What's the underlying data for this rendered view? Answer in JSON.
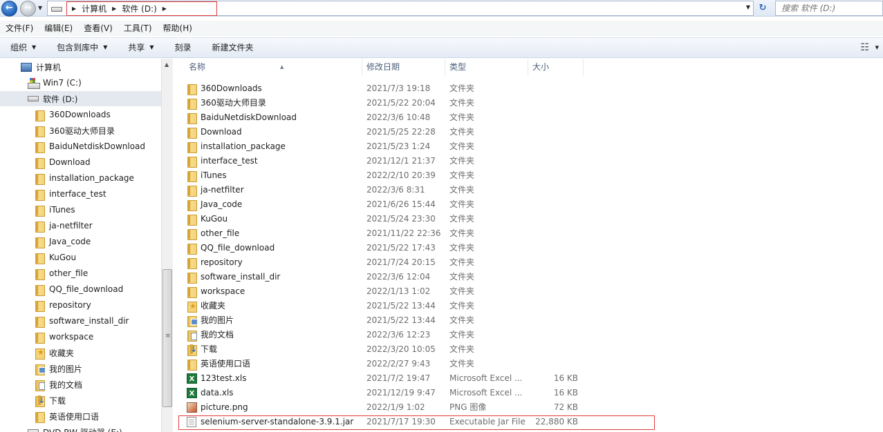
{
  "address": {
    "crumbs": [
      "计算机",
      "软件 (D:)"
    ],
    "search_placeholder": "搜索 软件 (D:)"
  },
  "menu": [
    "文件(F)",
    "编辑(E)",
    "查看(V)",
    "工具(T)",
    "帮助(H)"
  ],
  "commands": [
    {
      "label": "组织",
      "dropdown": true
    },
    {
      "label": "包含到库中",
      "dropdown": true
    },
    {
      "label": "共享",
      "dropdown": true
    },
    {
      "label": "刻录",
      "dropdown": false
    },
    {
      "label": "新建文件夹",
      "dropdown": false
    }
  ],
  "tree": [
    {
      "label": "计算机",
      "icon": "computer-icon",
      "depth": 0
    },
    {
      "label": "Win7 (C:)",
      "icon": "windows-drive-icon",
      "depth": 1
    },
    {
      "label": "软件 (D:)",
      "icon": "hard-drive-icon",
      "depth": 1,
      "selected": true
    },
    {
      "label": "360Downloads",
      "icon": "folder-icon",
      "depth": 2
    },
    {
      "label": "360驱动大师目录",
      "icon": "folder-icon",
      "depth": 2
    },
    {
      "label": "BaiduNetdiskDownload",
      "icon": "folder-icon",
      "depth": 2
    },
    {
      "label": "Download",
      "icon": "folder-icon",
      "depth": 2
    },
    {
      "label": "installation_package",
      "icon": "folder-icon",
      "depth": 2
    },
    {
      "label": "interface_test",
      "icon": "folder-icon",
      "depth": 2
    },
    {
      "label": "iTunes",
      "icon": "folder-icon",
      "depth": 2
    },
    {
      "label": "ja-netfilter",
      "icon": "folder-icon",
      "depth": 2
    },
    {
      "label": "Java_code",
      "icon": "folder-icon",
      "depth": 2
    },
    {
      "label": "KuGou",
      "icon": "folder-icon",
      "depth": 2
    },
    {
      "label": "other_file",
      "icon": "folder-icon",
      "depth": 2
    },
    {
      "label": "QQ_file_download",
      "icon": "folder-icon",
      "depth": 2
    },
    {
      "label": "repository",
      "icon": "folder-icon",
      "depth": 2
    },
    {
      "label": "software_install_dir",
      "icon": "folder-icon",
      "depth": 2
    },
    {
      "label": "workspace",
      "icon": "folder-icon",
      "depth": 2
    },
    {
      "label": "收藏夹",
      "icon": "favorites-folder-icon",
      "depth": 2
    },
    {
      "label": "我的图片",
      "icon": "pictures-folder-icon",
      "depth": 2
    },
    {
      "label": "我的文档",
      "icon": "documents-folder-icon",
      "depth": 2
    },
    {
      "label": "下载",
      "icon": "downloads-folder-icon",
      "depth": 2
    },
    {
      "label": "英语使用口语",
      "icon": "folder-icon",
      "depth": 2
    },
    {
      "label": "DVD RW 驱动器 (E:)",
      "icon": "dvd-drive-icon",
      "depth": 1
    }
  ],
  "columns": [
    "名称",
    "修改日期",
    "类型",
    "大小"
  ],
  "files": [
    {
      "name": "360Downloads",
      "date": "2021/7/3 19:18",
      "type": "文件夹",
      "size": "",
      "icon": "folder-icon"
    },
    {
      "name": "360驱动大师目录",
      "date": "2021/5/22 20:04",
      "type": "文件夹",
      "size": "",
      "icon": "folder-icon"
    },
    {
      "name": "BaiduNetdiskDownload",
      "date": "2022/3/6 10:48",
      "type": "文件夹",
      "size": "",
      "icon": "folder-icon"
    },
    {
      "name": "Download",
      "date": "2021/5/25 22:28",
      "type": "文件夹",
      "size": "",
      "icon": "folder-icon"
    },
    {
      "name": "installation_package",
      "date": "2021/5/23 1:24",
      "type": "文件夹",
      "size": "",
      "icon": "folder-icon"
    },
    {
      "name": "interface_test",
      "date": "2021/12/1 21:37",
      "type": "文件夹",
      "size": "",
      "icon": "folder-icon"
    },
    {
      "name": "iTunes",
      "date": "2022/2/10 20:39",
      "type": "文件夹",
      "size": "",
      "icon": "folder-icon"
    },
    {
      "name": "ja-netfilter",
      "date": "2022/3/6 8:31",
      "type": "文件夹",
      "size": "",
      "icon": "folder-icon"
    },
    {
      "name": "Java_code",
      "date": "2021/6/26 15:44",
      "type": "文件夹",
      "size": "",
      "icon": "folder-icon"
    },
    {
      "name": "KuGou",
      "date": "2021/5/24 23:30",
      "type": "文件夹",
      "size": "",
      "icon": "folder-icon"
    },
    {
      "name": "other_file",
      "date": "2021/11/22 22:36",
      "type": "文件夹",
      "size": "",
      "icon": "folder-icon"
    },
    {
      "name": "QQ_file_download",
      "date": "2021/5/22 17:43",
      "type": "文件夹",
      "size": "",
      "icon": "folder-icon"
    },
    {
      "name": "repository",
      "date": "2021/7/24 20:15",
      "type": "文件夹",
      "size": "",
      "icon": "folder-icon"
    },
    {
      "name": "software_install_dir",
      "date": "2022/3/6 12:04",
      "type": "文件夹",
      "size": "",
      "icon": "folder-icon"
    },
    {
      "name": "workspace",
      "date": "2022/1/13 1:02",
      "type": "文件夹",
      "size": "",
      "icon": "folder-icon"
    },
    {
      "name": "收藏夹",
      "date": "2021/5/22 13:44",
      "type": "文件夹",
      "size": "",
      "icon": "favorites-folder-icon"
    },
    {
      "name": "我的图片",
      "date": "2021/5/22 13:44",
      "type": "文件夹",
      "size": "",
      "icon": "pictures-folder-icon"
    },
    {
      "name": "我的文档",
      "date": "2022/3/6 12:23",
      "type": "文件夹",
      "size": "",
      "icon": "documents-folder-icon"
    },
    {
      "name": "下载",
      "date": "2022/3/20 10:05",
      "type": "文件夹",
      "size": "",
      "icon": "downloads-folder-icon"
    },
    {
      "name": "英语使用口语",
      "date": "2022/2/27 9:43",
      "type": "文件夹",
      "size": "",
      "icon": "folder-icon"
    },
    {
      "name": "123test.xls",
      "date": "2021/7/2 19:47",
      "type": "Microsoft Excel ...",
      "size": "16 KB",
      "icon": "excel-file-icon"
    },
    {
      "name": "data.xls",
      "date": "2021/12/19 9:47",
      "type": "Microsoft Excel ...",
      "size": "16 KB",
      "icon": "excel-file-icon"
    },
    {
      "name": "picture.png",
      "date": "2022/1/9 1:02",
      "type": "PNG 图像",
      "size": "72 KB",
      "icon": "png-file-icon"
    },
    {
      "name": "selenium-server-standalone-3.9.1.jar",
      "date": "2021/7/17 19:30",
      "type": "Executable Jar File",
      "size": "22,880 KB",
      "icon": "jar-file-icon"
    }
  ],
  "colors": {
    "highlight_box": "#e23b3b",
    "selected_row": "#e4e9f0"
  }
}
